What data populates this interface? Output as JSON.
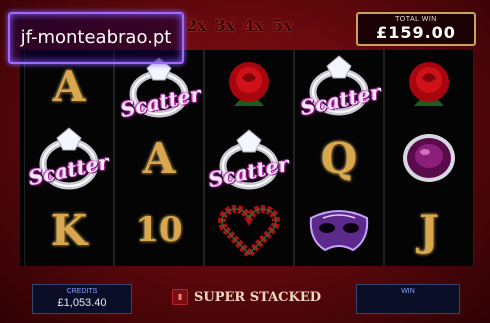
{
  "watermark": {
    "text": "jf-monteabrao.pt"
  },
  "multipliers": [
    "2x",
    "3x",
    "4x",
    "5x"
  ],
  "total_win": {
    "label": "TOTAL WIN",
    "value": "£159.00"
  },
  "reels": [
    [
      "A",
      "ring-scatter",
      "K"
    ],
    [
      "ring-scatter",
      "A",
      "10"
    ],
    [
      "rose",
      "ring-scatter",
      "heart-wreath"
    ],
    [
      "ring-scatter",
      "Q",
      "masquerade-mask"
    ],
    [
      "rose",
      "gemstone-ring",
      "J"
    ]
  ],
  "scatter_text": "Scatter",
  "credits": {
    "label": "CREDITS",
    "value": "£1,053.40"
  },
  "win": {
    "label": "WIN",
    "value": ""
  },
  "super_stacked": {
    "text": "SUPER STACKED"
  },
  "colors": {
    "gold": "#d9a84e",
    "background_red": "#8e1016",
    "watermark_border": "#9b6bff"
  }
}
